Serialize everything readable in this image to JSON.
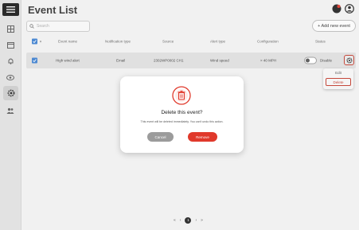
{
  "page": {
    "title": "Event List"
  },
  "sidebar": {
    "items": [
      {
        "icon": "menu-icon"
      },
      {
        "icon": "grid-icon"
      },
      {
        "icon": "calendar-icon"
      },
      {
        "icon": "bell-icon"
      },
      {
        "icon": "eye-icon"
      },
      {
        "icon": "settings-icon",
        "active": true
      },
      {
        "icon": "users-icon"
      }
    ]
  },
  "search": {
    "placeholder": "Search"
  },
  "toolbar": {
    "add_label": "+ Add new event"
  },
  "table": {
    "headers": [
      "Event name",
      "Notification type",
      "Source",
      "Alert type",
      "Configuration",
      "Status"
    ],
    "rows": [
      {
        "event_name": "High wind alert",
        "notification_type": "Email",
        "source": "2302WP0002 CH1",
        "alert_type": "Wind speed",
        "configuration": "> 40 MPH",
        "status": "Disable"
      }
    ]
  },
  "row_menu": {
    "edit": "Edit",
    "delete": "Delete"
  },
  "modal": {
    "title": "Delete this event?",
    "message": "This event will be deleted immediately. You can't undo this action.",
    "cancel": "Cancel",
    "remove": "Remove"
  },
  "pagination": {
    "first": "«",
    "prev": "‹",
    "current": "1",
    "next": "›",
    "last": "»"
  },
  "colors": {
    "accent": "#e0392b",
    "primary": "#3d7fcf",
    "sidebar": "#e2e2e2"
  }
}
